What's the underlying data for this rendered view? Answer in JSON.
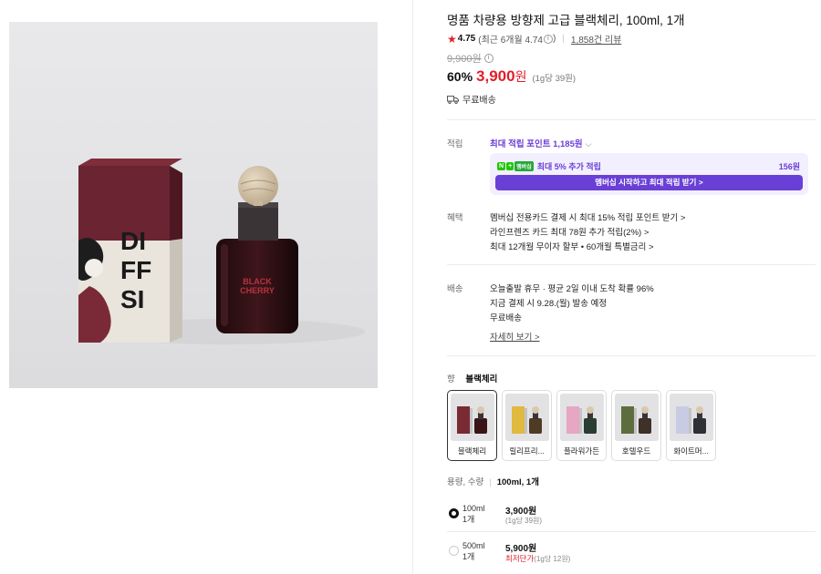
{
  "product": {
    "title": "명품 차량용 방향제 고급 블랙체리, 100ml, 1개",
    "rating": "4.75",
    "recent_rating_text": "(최근 6개월 4.74",
    "recent_rating_close": ")",
    "review_count": "1,858건 리뷰",
    "original_price": "9,900원",
    "discount": "60%",
    "price": "3,900",
    "price_unit": "원",
    "unit_price": "(1g당 39원)",
    "shipping": "무료배송",
    "image_text_box": "DI FF SI",
    "image_text_bottle": "BLACK CHERRY"
  },
  "points": {
    "label": "적립",
    "max_text": "최대 적립 포인트 1,185원",
    "member_text": "최대 5% 추가 적립",
    "member_amount": "156원",
    "badge_n": "N",
    "badge_plus": "+",
    "badge_membership": "멤버십",
    "member_button": "멤버십 시작하고 최대 적립 받기 >"
  },
  "benefits": {
    "label": "혜택",
    "items": [
      "멤버십 전용카드 결제 시 최대 15% 적립 포인트 받기 >",
      "라인프렌즈 카드 최대 78원 추가 적립(2%) >",
      "최대 12개월 무이자 할부 • 60개월 특별금리 >"
    ]
  },
  "delivery": {
    "label": "배송",
    "line1": "오늘출발 휴무  ·  평균 2일 이내 도착 확률 96%",
    "line2": "지금 결제 시 9.28.(월) 발송 예정",
    "line3": "무료배송",
    "details_link": "자세히 보기 >"
  },
  "scent": {
    "label": "향",
    "selected": "블랙체리",
    "options": [
      {
        "label": "블랙체리",
        "box": "#7a2a33",
        "bottle": "#3a1518"
      },
      {
        "label": "릴리프리...",
        "box": "#e0b93f",
        "bottle": "#4f3a24"
      },
      {
        "label": "플라워가든",
        "box": "#e7a6c2",
        "bottle": "#2a3d32"
      },
      {
        "label": "호텔우드",
        "box": "#5d6d3d",
        "bottle": "#3e3127"
      },
      {
        "label": "화이트머...",
        "box": "#c8cbe2",
        "bottle": "#2f2f36"
      }
    ]
  },
  "volume": {
    "label": "용량, 수량",
    "selected": "100ml, 1개",
    "options": [
      {
        "vol": "100ml",
        "qty": "1개",
        "price": "3,900원",
        "sub": "(1g당 39원)",
        "tag": ""
      },
      {
        "vol": "500ml",
        "qty": "1개",
        "price": "5,900원",
        "sub": "(1g당 12원)",
        "tag": "최저단가"
      }
    ]
  },
  "colors": {
    "accent_red": "#e11f2b",
    "membership_purple": "#6a3fd6",
    "naver_green": "#1ec800"
  }
}
